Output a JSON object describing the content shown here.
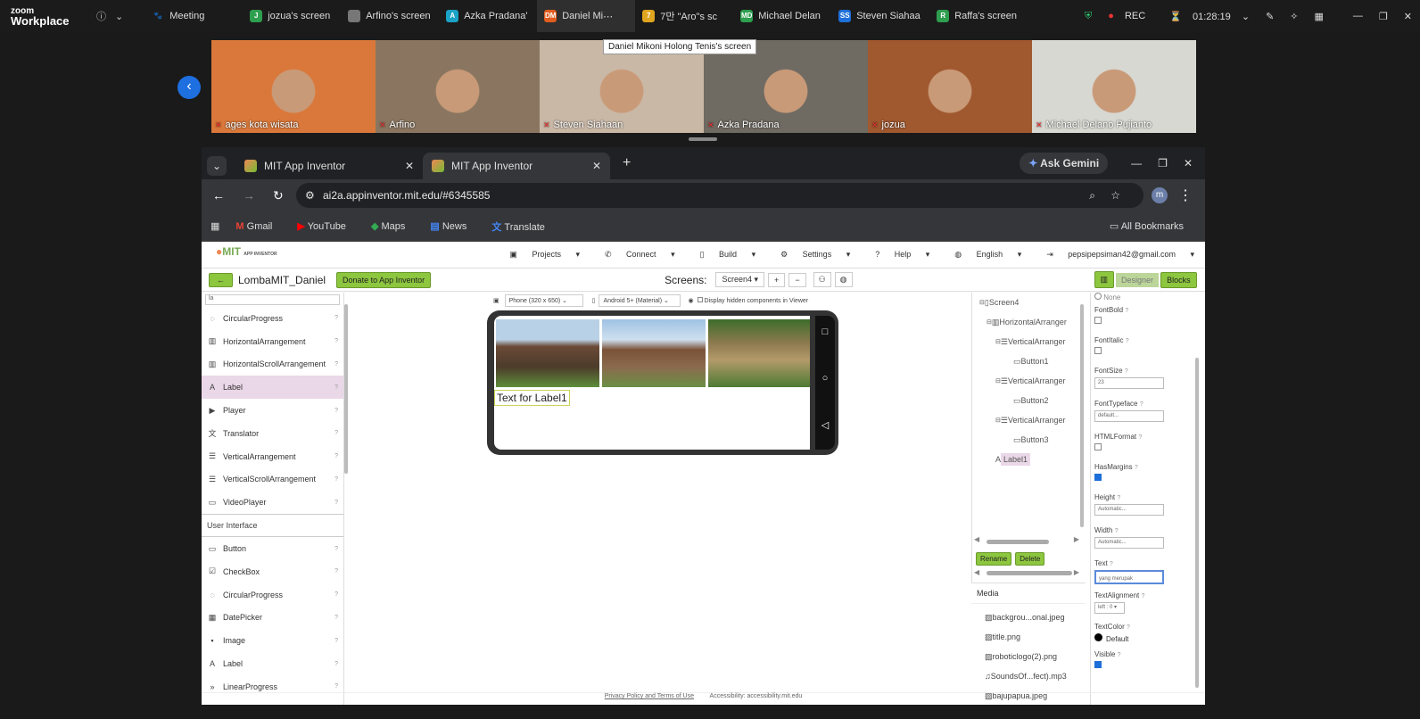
{
  "zoom": {
    "logo_top": "zoom",
    "logo_bottom": "Workplace",
    "tabs": [
      {
        "label": "Meeting",
        "badge": "",
        "color": "#1b1b1b",
        "active": false
      },
      {
        "label": "jozua's screen",
        "badge": "J",
        "color": "#2e9e4f",
        "active": false
      },
      {
        "label": "Arfino's screen",
        "badge": "",
        "color": "#777777",
        "active": false
      },
      {
        "label": "Azka Pradana'",
        "badge": "A",
        "color": "#1aa3c7",
        "active": false
      },
      {
        "label": "Daniel Mi",
        "badge": "DM",
        "color": "#e05d1f",
        "active": true
      },
      {
        "label": "7만 \"Aro\"s sc",
        "badge": "7",
        "color": "#e0a51f",
        "active": false
      },
      {
        "label": "Michael Delan",
        "badge": "MD",
        "color": "#2e9e4f",
        "active": false
      },
      {
        "label": "Steven Siahaa",
        "badge": "SS",
        "color": "#1e6fd9",
        "active": false
      },
      {
        "label": "Raffa's screen",
        "badge": "R",
        "color": "#2e9e4f",
        "active": false
      }
    ],
    "rec": "REC",
    "timer": "01:28:19",
    "tooltip": "Daniel Mikoni Holong Tenis's screen",
    "participants": [
      {
        "name": "ages kota wisata",
        "color": "#d9783a"
      },
      {
        "name": "Arfino",
        "color": "#8a7660"
      },
      {
        "name": "Steven Siahaan",
        "color": "#c9b8a6"
      },
      {
        "name": "Azka Pradana",
        "color": "#6f6a62"
      },
      {
        "name": "jozua",
        "color": "#a0582f"
      },
      {
        "name": "Michael Delano Pujianto",
        "color": "#d8d8d2"
      }
    ]
  },
  "browser": {
    "tabs": [
      "MIT App Inventor",
      "MIT App Inventor"
    ],
    "url": "ai2a.appinventor.mit.edu/#6345585",
    "ask_gemini": "Ask Gemini",
    "bookmarks": [
      "Gmail",
      "YouTube",
      "Maps",
      "News",
      "Translate"
    ],
    "all_bookmarks": "All Bookmarks",
    "profile": "m"
  },
  "app": {
    "logo_title": "MIT",
    "logo_sub": "APP INVENTOR",
    "menu": [
      "Projects",
      "Connect",
      "Build",
      "Settings",
      "Help",
      "English",
      "pepsipepsiman42@gmail.com"
    ],
    "project": "LombaMIT_Daniel",
    "donate": "Donate to App Inventor",
    "screens_label": "Screens:",
    "screen": "Screen4",
    "designer": "Designer",
    "blocks": "Blocks",
    "palette_search": "la",
    "palette": [
      "CircularProgress",
      "HorizontalArrangement",
      "HorizontalScrollArrangement",
      "Label",
      "Player",
      "Translator",
      "VerticalArrangement",
      "VerticalScrollArrangement",
      "VideoPlayer"
    ],
    "palette_section": "User Interface",
    "palette_ui": [
      "Button",
      "CheckBox",
      "CircularProgress",
      "DatePicker",
      "Image",
      "Label",
      "LinearProgress"
    ],
    "viewer_phone": "Phone (320 x 650)",
    "viewer_theme": "Android 5+ (Material)",
    "viewer_hidden": "Display hidden components in Viewer",
    "label_text": "Text for Label1",
    "tree": [
      "Screen4",
      "HorizontalArranger",
      "VerticalArranger",
      "Button1",
      "VerticalArranger",
      "Button2",
      "VerticalArranger",
      "Button3",
      "Label1"
    ],
    "rename": "Rename",
    "delete": "Delete",
    "media_title": "Media",
    "media": [
      "backgrou...onal.jpeg",
      "title.png",
      "roboticlogo(2).png",
      "SoundsOf...fect).mp3",
      "bajupapua.jpeg"
    ],
    "props": {
      "none": "None",
      "fontbold": "FontBold",
      "fontitalic": "FontItalic",
      "fontsize": "FontSize",
      "fontsize_val": "23",
      "typeface": "FontTypeface",
      "typeface_val": "default...",
      "html": "HTMLFormat",
      "margins": "HasMargins",
      "height": "Height",
      "height_val": "Automatic...",
      "width": "Width",
      "width_val": "Automatic...",
      "text": "Text",
      "text_val": "yang merupak",
      "align": "TextAlignment",
      "align_val": "left : 0",
      "color": "TextColor",
      "color_val": "Default",
      "visible": "Visible"
    },
    "footer": "Privacy Policy and Terms of Use",
    "footer2": "Accessibility: accessibility.mit.edu"
  }
}
